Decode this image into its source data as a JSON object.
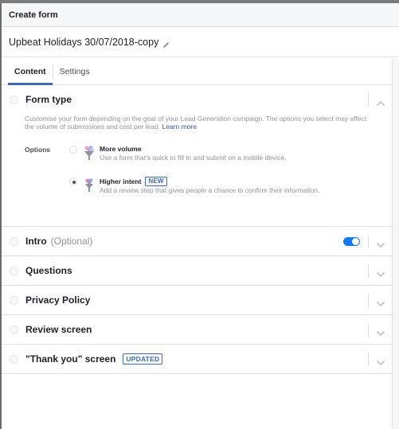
{
  "header": {
    "title": "Create form"
  },
  "form": {
    "name": "Upbeat Holidays 30/07/2018-copy",
    "edit_icon": "pencil-icon"
  },
  "tabs": [
    {
      "label": "Content",
      "active": true
    },
    {
      "label": "Settings",
      "active": false
    }
  ],
  "sections": {
    "form_type": {
      "title": "Form type",
      "expanded": true,
      "description": "Customise your form depending on the goal of your Lead Generation campaign. The options you select may affect the volume of submissions and cost per lead.",
      "learn_more": "Learn more",
      "options_label": "Options",
      "options": [
        {
          "title": "More volume",
          "description": "Use a form that's quick to fill in and submit on a mobile device.",
          "selected": false,
          "badge": ""
        },
        {
          "title": "Higher intent",
          "description": "Add a review step that gives people a chance to confirm their information.",
          "selected": true,
          "badge": "NEW"
        }
      ]
    },
    "intro": {
      "title": "Intro",
      "optional": "(Optional)",
      "toggle_on": true
    },
    "questions": {
      "title": "Questions"
    },
    "privacy_policy": {
      "title": "Privacy Policy"
    },
    "review_screen": {
      "title": "Review screen"
    },
    "thank_you": {
      "title": "\"Thank you\" screen",
      "badge": "UPDATED"
    }
  },
  "colors": {
    "accent": "#4267b2",
    "toggle": "#1877f2",
    "link": "#365899"
  }
}
